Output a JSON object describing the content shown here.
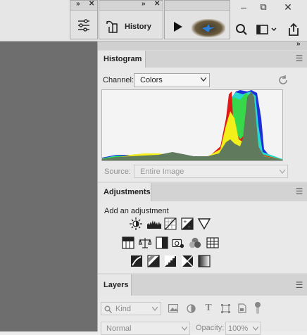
{
  "window_controls": {
    "minimize": "–",
    "restore": "⧉",
    "close": "✕"
  },
  "floating_panels": {
    "properties": {
      "icon": "sliders-icon"
    },
    "history": {
      "label": "History",
      "icon": "history-icon"
    },
    "actions": {
      "icon": "play-icon"
    }
  },
  "panel_strip_chevrons": "»",
  "histogram": {
    "tab_label": "Histogram",
    "channel_label": "Channel:",
    "channel_value": "Colors",
    "source_label": "Source:",
    "source_value": "Entire Image"
  },
  "adjustments": {
    "tab_label": "Adjustments",
    "subtitle": "Add an adjustment",
    "rows": [
      [
        "brightness-contrast-icon",
        "levels-icon",
        "curves-icon",
        "exposure-icon",
        "vibrance-icon"
      ],
      [
        "hue-saturation-icon",
        "color-balance-icon",
        "black-white-icon",
        "photo-filter-icon",
        "channel-mixer-icon",
        "color-lookup-icon"
      ],
      [
        "invert-icon",
        "posterize-icon",
        "threshold-icon",
        "selective-color-icon",
        "gradient-map-icon"
      ]
    ]
  },
  "layers": {
    "tab_label": "Layers",
    "kind_placeholder": "Kind",
    "blend_mode": "Normal",
    "opacity_label": "Opacity:",
    "opacity_value": "100%"
  },
  "colors": {
    "canvas_bg": "#6e6e6e",
    "panel_bg": "#e9e9e9",
    "accent": "#2a7fd8"
  }
}
